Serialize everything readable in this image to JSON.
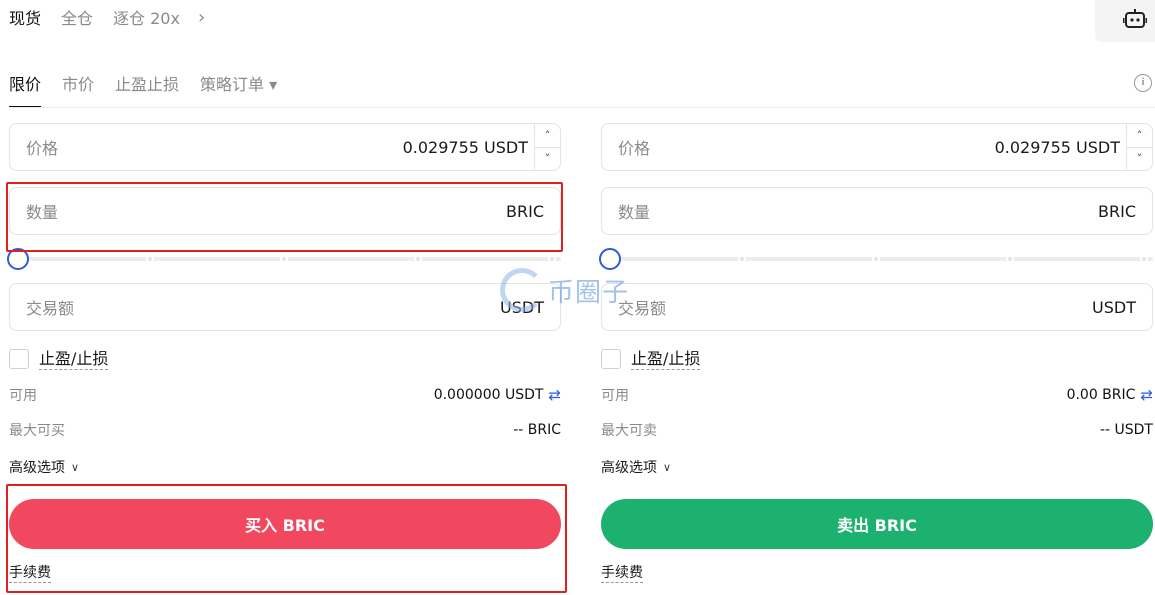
{
  "top_tabs": [
    {
      "label": "现货",
      "active": true
    },
    {
      "label": "全仓",
      "active": false
    },
    {
      "label": "逐仓 20x",
      "active": false
    }
  ],
  "top_chevron_icon": "chevron-right-icon",
  "bot_icon": "robot-icon",
  "order_tabs": [
    {
      "label": "限价",
      "active": true
    },
    {
      "label": "市价",
      "active": false
    },
    {
      "label": "止盈止损",
      "active": false
    },
    {
      "label": "策略订单 ▾",
      "active": false
    }
  ],
  "info_icon": "info-icon",
  "buy": {
    "price_label": "价格",
    "price_value": "0.029755 USDT",
    "qty_label": "数量",
    "qty_unit": "BRIC",
    "total_label": "交易额",
    "total_unit": "USDT",
    "tpsl_label": "止盈/止损",
    "available_label": "可用",
    "available_value": "0.000000 USDT",
    "max_label": "最大可买",
    "max_value": "-- BRIC",
    "advanced_label": "高级选项",
    "button_label": "买入 BRIC",
    "fee_label": "手续费"
  },
  "sell": {
    "price_label": "价格",
    "price_value": "0.029755 USDT",
    "qty_label": "数量",
    "qty_unit": "BRIC",
    "total_label": "交易额",
    "total_unit": "USDT",
    "tpsl_label": "止盈/止损",
    "available_label": "可用",
    "available_value": "0.00 BRIC",
    "max_label": "最大可卖",
    "max_value": "-- USDT",
    "advanced_label": "高级选项",
    "button_label": "卖出 BRIC",
    "fee_label": "手续费"
  },
  "slider_value_percent": 0,
  "watermark_text": "币圈子",
  "colors": {
    "buy": "#f14860",
    "sell": "#1db16f",
    "accent": "#2d5bd6",
    "highlight": "#e0201f"
  }
}
